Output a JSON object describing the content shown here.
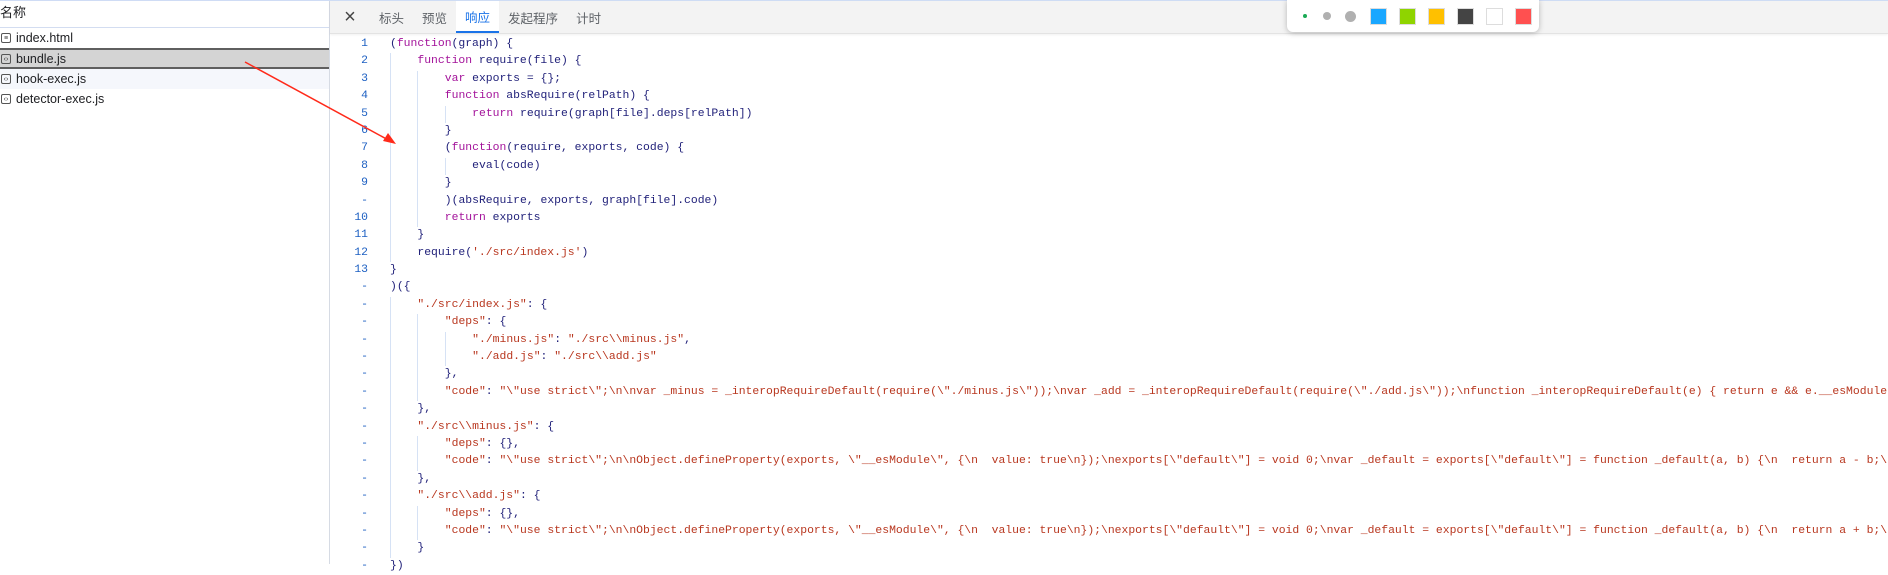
{
  "sidebar": {
    "header": "名称",
    "files": [
      {
        "name": "index.html",
        "icon": "document-icon"
      },
      {
        "name": "bundle.js",
        "icon": "script-icon",
        "selected": true
      },
      {
        "name": "hook-exec.js",
        "icon": "script-icon"
      },
      {
        "name": "detector-exec.js",
        "icon": "script-icon"
      }
    ]
  },
  "panel": {
    "close_icon": "×",
    "tabs": [
      {
        "label": "标头"
      },
      {
        "label": "预览"
      },
      {
        "label": "响应",
        "active": true
      },
      {
        "label": "发起程序"
      },
      {
        "label": "计时"
      }
    ]
  },
  "code_lines": [
    {
      "num": "1",
      "indent": 0,
      "text": "(function(graph) {"
    },
    {
      "num": "2",
      "indent": 1,
      "text": "function require(file) {"
    },
    {
      "num": "3",
      "indent": 2,
      "text": "var exports = {};"
    },
    {
      "num": "4",
      "indent": 2,
      "text": "function absRequire(relPath) {"
    },
    {
      "num": "5",
      "indent": 3,
      "text": "return require(graph[file].deps[relPath])"
    },
    {
      "num": "6",
      "indent": 2,
      "text": "}"
    },
    {
      "num": "7",
      "indent": 2,
      "text": "(function(require, exports, code) {"
    },
    {
      "num": "8",
      "indent": 3,
      "text": "eval(code)"
    },
    {
      "num": "9",
      "indent": 2,
      "text": "}"
    },
    {
      "num": "-",
      "indent": 2,
      "text": ")(absRequire, exports, graph[file].code)"
    },
    {
      "num": "10",
      "indent": 2,
      "text": "return exports"
    },
    {
      "num": "11",
      "indent": 1,
      "text": "}"
    },
    {
      "num": "12",
      "indent": 1,
      "text": "require('./src/index.js')"
    },
    {
      "num": "13",
      "indent": 0,
      "text": "}"
    },
    {
      "num": "-",
      "indent": 0,
      "text": ")({"
    },
    {
      "num": "-",
      "indent": 1,
      "text": "\"./src/index.js\": {"
    },
    {
      "num": "-",
      "indent": 2,
      "text": "\"deps\": {"
    },
    {
      "num": "-",
      "indent": 3,
      "text": "\"./minus.js\": \"./src\\\\minus.js\","
    },
    {
      "num": "-",
      "indent": 3,
      "text": "\"./add.js\": \"./src\\\\add.js\""
    },
    {
      "num": "-",
      "indent": 2,
      "text": "},"
    },
    {
      "num": "-",
      "indent": 2,
      "text": "\"code\": \"\\\"use strict\\\";\\n\\nvar _minus = _interopRequireDefault(require(\\\"./minus.js\\\"));\\nvar _add = _interopRequireDefault(require(\\\"./add.js\\\"));\\nfunction _interopRequireDefault(e) { return e && e.__esModule ? e : {"
    },
    {
      "num": "-",
      "indent": 1,
      "text": "},"
    },
    {
      "num": "-",
      "indent": 1,
      "text": "\"./src\\\\minus.js\": {"
    },
    {
      "num": "-",
      "indent": 2,
      "text": "\"deps\": {},"
    },
    {
      "num": "-",
      "indent": 2,
      "text": "\"code\": \"\\\"use strict\\\";\\n\\nObject.defineProperty(exports, \\\"__esModule\\\", {\\n  value: true\\n});\\nexports[\\\"default\\\"] = void 0;\\nvar _default = exports[\\\"default\\\"] = function _default(a, b) {\\n  return a - b;\\n};\""
    },
    {
      "num": "-",
      "indent": 1,
      "text": "},"
    },
    {
      "num": "-",
      "indent": 1,
      "text": "\"./src\\\\add.js\": {"
    },
    {
      "num": "-",
      "indent": 2,
      "text": "\"deps\": {},"
    },
    {
      "num": "-",
      "indent": 2,
      "text": "\"code\": \"\\\"use strict\\\";\\n\\nObject.defineProperty(exports, \\\"__esModule\\\", {\\n  value: true\\n});\\nexports[\\\"default\\\"] = void 0;\\nvar _default = exports[\\\"default\\\"] = function _default(a, b) {\\n  return a + b;\\n};\""
    },
    {
      "num": "-",
      "indent": 1,
      "text": "}"
    },
    {
      "num": "-",
      "indent": 0,
      "text": "})"
    }
  ],
  "annotation_toolbar": {
    "pen_sizes": [
      "small",
      "medium",
      "large"
    ],
    "active_pen_color": "#1aaa55",
    "colors": [
      "#1aa7ff",
      "#8fd400",
      "#ffc000",
      "#444444",
      "#ffffff",
      "#ff5050"
    ]
  },
  "annotation": {
    "arrow_color": "#ff2a1a"
  },
  "syntax_colors": {
    "keyword": "#a3129a",
    "string": "#b8361e",
    "line_number": "#1c5fc2",
    "accent": "#1a73e8"
  }
}
